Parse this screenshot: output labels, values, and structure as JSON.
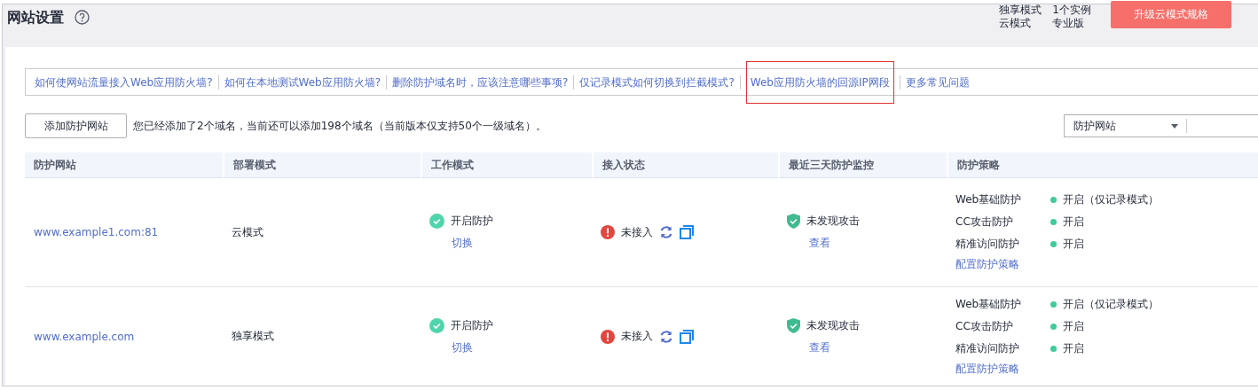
{
  "header": {
    "title": "网站设置",
    "info": [
      {
        "label": "独享模式",
        "value": "1个实例"
      },
      {
        "label": "云模式",
        "value": "专业版"
      }
    ],
    "upgrade_button": "升级云模式规格"
  },
  "faq_links": [
    {
      "label": "如何使网站流量接入Web应用防火墙?",
      "highlighted": false
    },
    {
      "label": "如何在本地测试Web应用防火墙?",
      "highlighted": false
    },
    {
      "label": "删除防护域名时，应该注意哪些事项?",
      "highlighted": false
    },
    {
      "label": "仅记录模式如何切换到拦截模式?",
      "highlighted": false
    },
    {
      "label": "Web应用防火墙的回源IP网段",
      "highlighted": true
    },
    {
      "label": "更多常见问题",
      "highlighted": false
    }
  ],
  "toolbar": {
    "add_button": "添加防护网站",
    "notice": "您已经添加了2个域名，当前还可以添加198个域名（当前版本仅支持50个一级域名）。",
    "filter_select": "防护网站"
  },
  "table": {
    "columns": [
      "防护网站",
      "部署模式",
      "工作模式",
      "接入状态",
      "最近三天防护监控",
      "防护策略"
    ],
    "rows": [
      {
        "site": "www.example1.com:81",
        "deploy": "云模式",
        "work": {
          "status": "开启防护",
          "action": "切换"
        },
        "access": {
          "status": "未接入",
          "connected": false
        },
        "monitor": {
          "status": "未发现攻击",
          "action": "查看"
        },
        "policies": [
          {
            "name": "Web基础防护",
            "status": "开启（仅记录模式）",
            "on": true
          },
          {
            "name": "CC攻击防护",
            "status": "开启",
            "on": true
          },
          {
            "name": "精准访问防护",
            "status": "开启",
            "on": true
          }
        ],
        "policy_link": "配置防护策略"
      },
      {
        "site": "www.example.com",
        "deploy": "独享模式",
        "work": {
          "status": "开启防护",
          "action": "切换"
        },
        "access": {
          "status": "未接入",
          "connected": false
        },
        "monitor": {
          "status": "未发现攻击",
          "action": "查看"
        },
        "policies": [
          {
            "name": "Web基础防护",
            "status": "开启（仅记录模式）",
            "on": true
          },
          {
            "name": "CC攻击防护",
            "status": "开启",
            "on": true
          },
          {
            "name": "精准访问防护",
            "status": "开启",
            "on": true
          }
        ],
        "policy_link": "配置防护策略"
      }
    ]
  }
}
